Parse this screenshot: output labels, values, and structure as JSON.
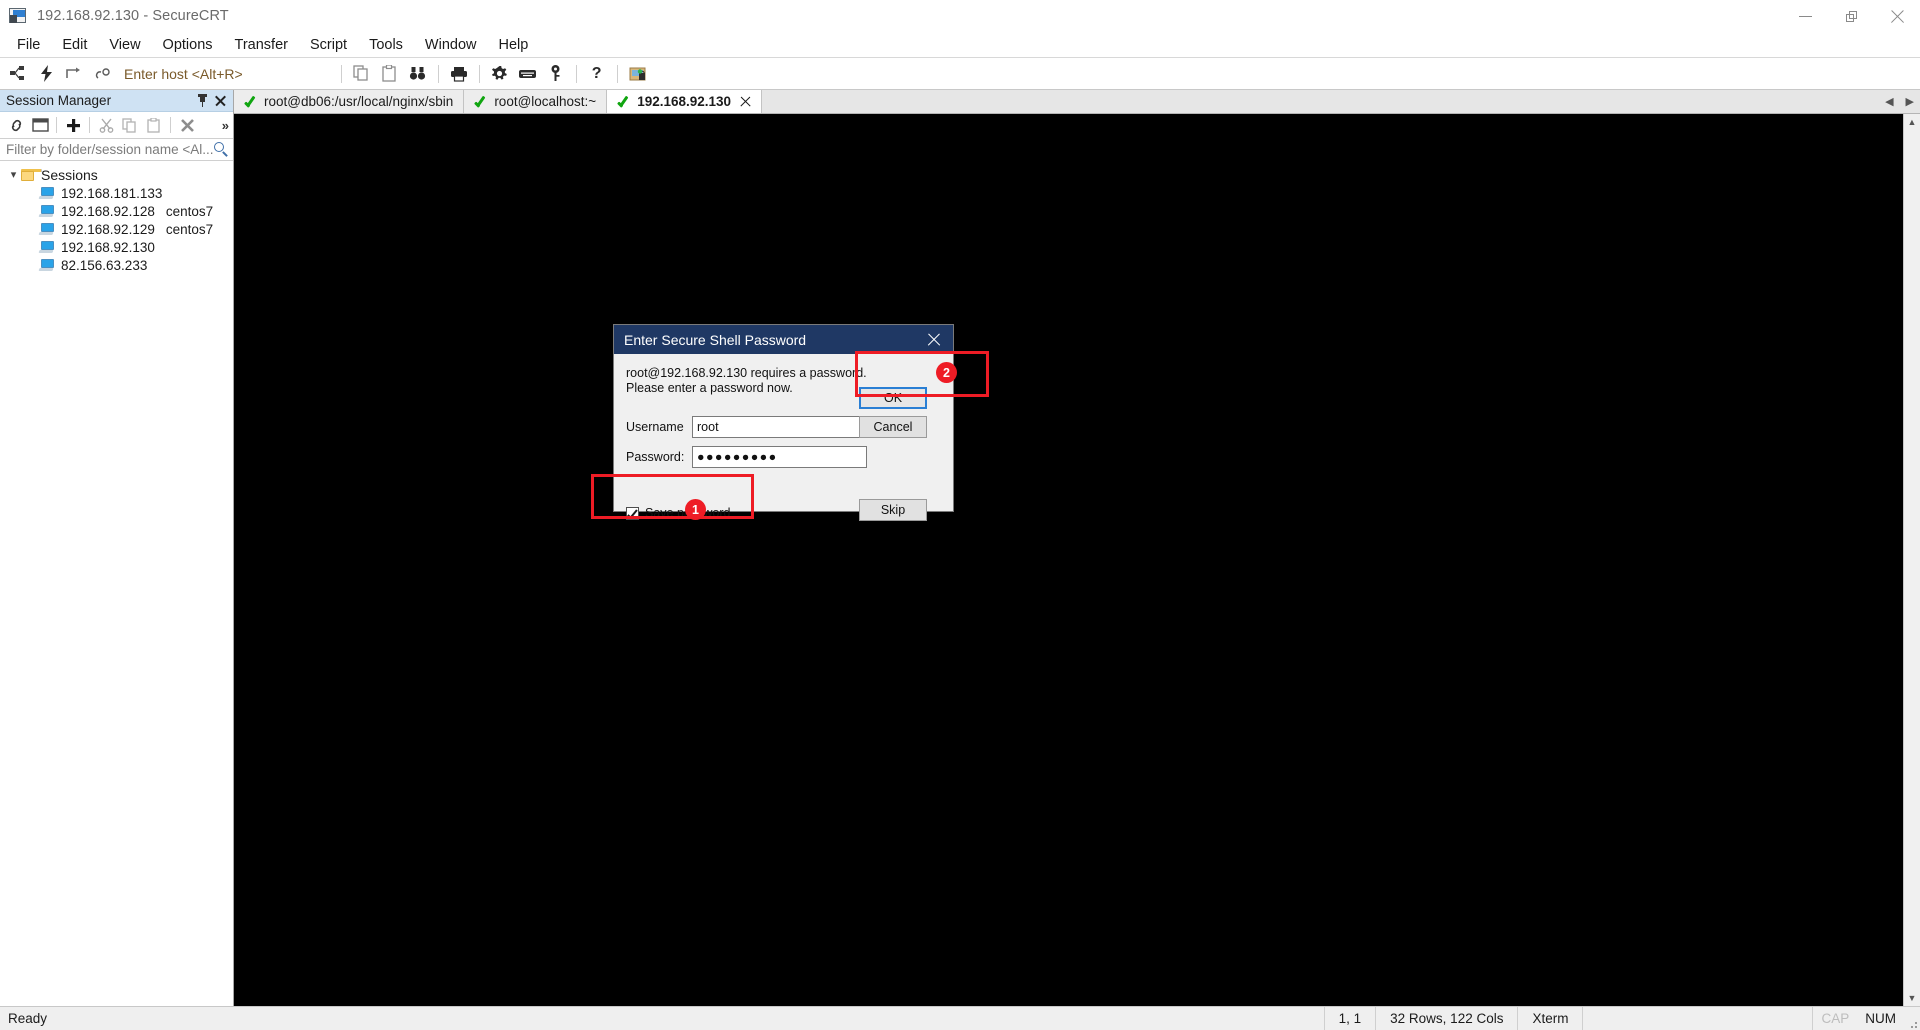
{
  "window": {
    "title": "192.168.92.130 - SecureCRT",
    "icon": "securecrt-app-icon",
    "controls": {
      "minimize": "minimize-icon",
      "maximize": "restore-icon",
      "close": "close-icon"
    }
  },
  "menubar": {
    "items": [
      "File",
      "Edit",
      "View",
      "Options",
      "Transfer",
      "Script",
      "Tools",
      "Window",
      "Help"
    ]
  },
  "toolbar": {
    "host_placeholder": "Enter host <Alt+R>",
    "icons": [
      "connect-icon",
      "quick-connect-icon",
      "reconnect-icon",
      "connect-sftp-icon",
      "copy-icon",
      "paste-icon",
      "find-icon",
      "print-icon",
      "settings-gear-icon",
      "keyboard-icon",
      "key-icon",
      "help-icon",
      "secure-file-transfer-icon"
    ]
  },
  "sidebar": {
    "header_title": "Session Manager",
    "header_icons": [
      "pin-icon",
      "close-icon"
    ],
    "toolbar_icons": [
      "connect-link-icon",
      "new-window-icon",
      "add-icon",
      "cut-icon",
      "copy-icon",
      "paste-icon",
      "delete-icon",
      "overflow-chevron-icon"
    ],
    "filter_placeholder": "Filter by folder/session name <Al...",
    "search_icon": "search-icon",
    "root": {
      "label": "Sessions",
      "expanded": true,
      "icon": "folder-icon"
    },
    "sessions": [
      {
        "name": "192.168.181.133",
        "note": ""
      },
      {
        "name": "192.168.92.128",
        "note": "centos7"
      },
      {
        "name": "192.168.92.129",
        "note": "centos7"
      },
      {
        "name": "192.168.92.130",
        "note": ""
      },
      {
        "name": "82.156.63.233",
        "note": ""
      }
    ]
  },
  "tabs": {
    "items": [
      {
        "label": "root@db06:/usr/local/nginx/sbin",
        "status_icon": "connected-check-icon",
        "active": false,
        "closable": false
      },
      {
        "label": "root@localhost:~",
        "status_icon": "connected-check-icon",
        "active": false,
        "closable": false
      },
      {
        "label": "192.168.92.130",
        "status_icon": "connected-check-icon",
        "active": true,
        "closable": true
      }
    ],
    "scroll_left": "◀",
    "scroll_right": "▶"
  },
  "dialog": {
    "title": "Enter Secure Shell Password",
    "close_icon": "close-icon",
    "message_line1": "root@192.168.92.130 requires a password.",
    "message_line2": "Please enter a password now.",
    "username_label": "Username",
    "username_value": "root",
    "password_label": "Password:",
    "password_value": "●●●●●●●●●",
    "save_password_label": "Save password",
    "save_password_checked": true,
    "buttons": {
      "ok": "OK",
      "cancel": "Cancel",
      "skip": "Skip"
    }
  },
  "annotations": [
    {
      "id": "1",
      "target": "save-password-checkbox"
    },
    {
      "id": "2",
      "target": "ok-button"
    }
  ],
  "statusbar": {
    "ready": "Ready",
    "cursor": "1,  1",
    "dimensions": "32 Rows, 122 Cols",
    "emulation": "Xterm",
    "cap": "CAP",
    "num": "NUM"
  },
  "colors": {
    "accent_blue": "#1f3864",
    "annotation_red": "#ee1c25",
    "terminal_bg": "#000000",
    "panel_header": "#cfe2f3",
    "focus_border": "#2a7fd4"
  }
}
